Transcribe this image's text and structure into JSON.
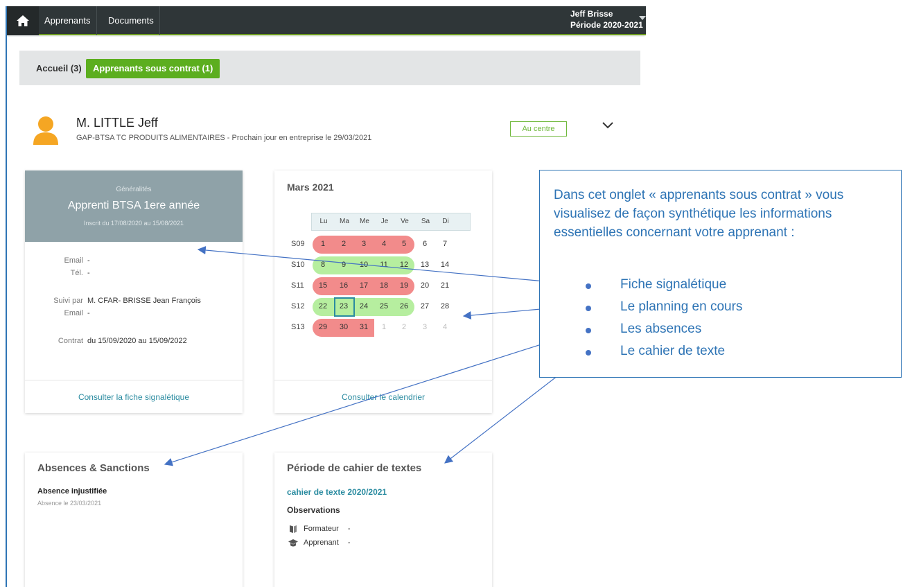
{
  "topbar": {
    "nav": [
      "Apprenants",
      "Documents"
    ],
    "user_name": "Jeff Brisse",
    "period": "Période 2020-2021"
  },
  "tabs": [
    {
      "label": "Accueil (3)",
      "active": false
    },
    {
      "label": "Apprenants sous contrat (1)",
      "active": true
    }
  ],
  "learner": {
    "name": "M. LITTLE Jeff",
    "subtitle": "GAP-BTSA TC PRODUITS ALIMENTAIRES - Prochain jour en entreprise le 29/03/2021",
    "status": "Au centre"
  },
  "general": {
    "label": "Généralités",
    "title": "Apprenti BTSA 1ere année",
    "enrolled": "Inscrit du 17/08/2020 au 15/08/2021",
    "email_label": "Email",
    "email_value": "-",
    "phone_label": "Tél.",
    "phone_value": "-",
    "follow_label": "Suivi par",
    "follow_value": "M. CFAR- BRISSE Jean François",
    "email2_label": "Email",
    "email2_value": "-",
    "contract_label": "Contrat",
    "contract_value": "du 15/09/2020 au 15/09/2022",
    "footer": "Consulter la fiche signalétique"
  },
  "calendar": {
    "title": "Mars 2021",
    "day_headers": [
      "Lu",
      "Ma",
      "Me",
      "Je",
      "Ve",
      "Sa",
      "Di"
    ],
    "weeks": [
      {
        "label": "S09",
        "days": [
          "1",
          "2",
          "3",
          "4",
          "5",
          "6",
          "7"
        ],
        "type": "red",
        "band_days": 5
      },
      {
        "label": "S10",
        "days": [
          "8",
          "9",
          "10",
          "11",
          "12",
          "13",
          "14"
        ],
        "type": "green",
        "band_days": 5
      },
      {
        "label": "S11",
        "days": [
          "15",
          "16",
          "17",
          "18",
          "19",
          "20",
          "21"
        ],
        "type": "red",
        "band_days": 5
      },
      {
        "label": "S12",
        "days": [
          "22",
          "23",
          "24",
          "25",
          "26",
          "27",
          "28"
        ],
        "type": "green",
        "band_days": 5
      },
      {
        "label": "S13",
        "days": [
          "29",
          "30",
          "31",
          "1",
          "2",
          "3",
          "4"
        ],
        "type": "red",
        "band_days": 3
      }
    ],
    "today": "23",
    "footer": "Consulter le calendrier",
    "colors": {
      "absent": "#f28b8b",
      "present": "#b6ee9f",
      "today": "#2a8ba0"
    }
  },
  "absences": {
    "title": "Absences & Sanctions",
    "item_title": "Absence injustifiée",
    "item_date": "Absence le 23/03/2021"
  },
  "textbook": {
    "title": "Période de cahier de textes",
    "link": "cahier de texte 2020/2021",
    "obs_title": "Observations",
    "trainer_label": "Formateur",
    "trainer_value": "-",
    "learner_label": "Apprenant",
    "learner_value": "-"
  },
  "callout": {
    "text": "Dans cet onglet « apprenants sous contrat » vous visualisez de façon synthétique les informations essentielles concernant votre apprenant :",
    "bullets": [
      "Fiche signalétique",
      "Le planning en cours",
      "Les absences",
      "Le cahier de texte"
    ]
  },
  "icons": [
    "home-icon",
    "chevron-down-icon",
    "user-avatar-icon",
    "book-icon",
    "graduation-cap-icon"
  ]
}
